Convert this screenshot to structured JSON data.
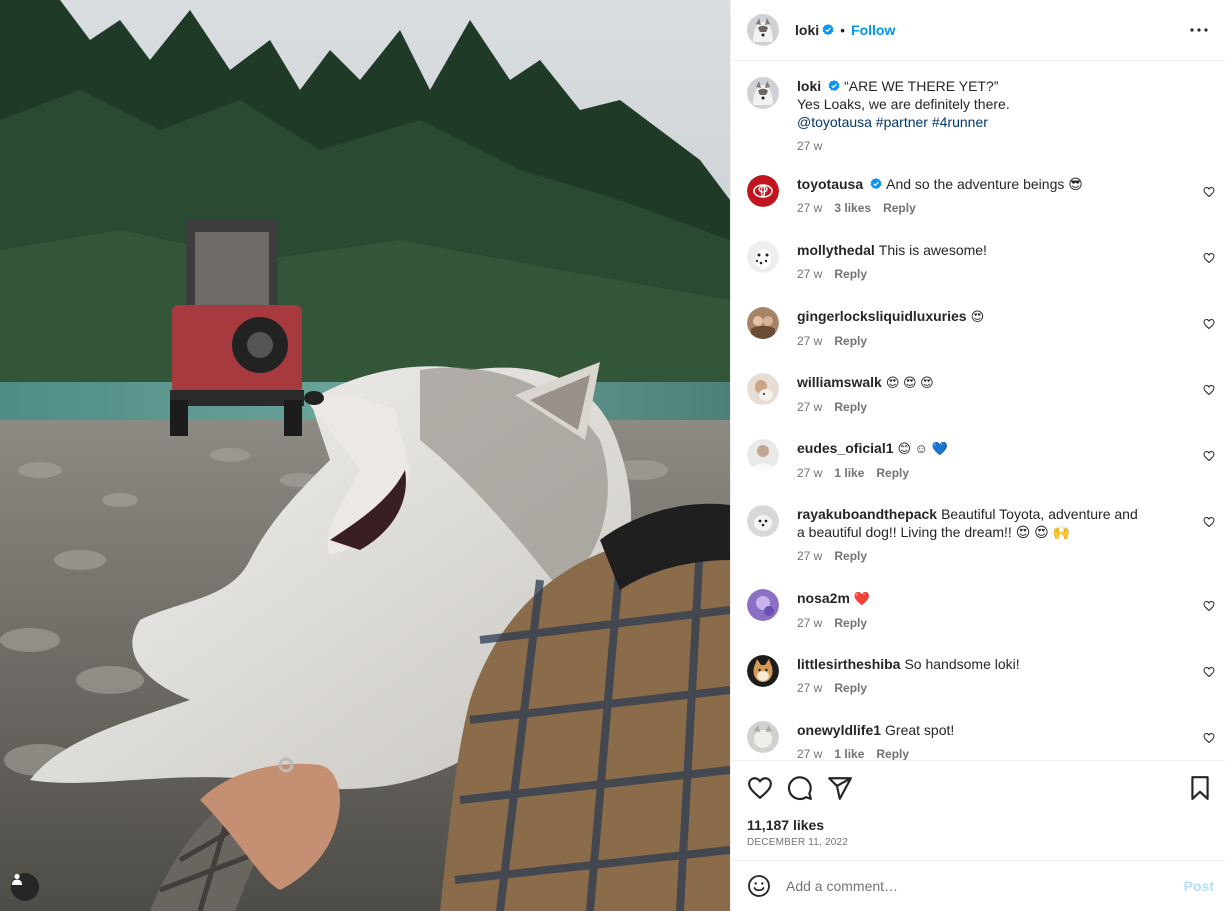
{
  "header": {
    "username": "loki",
    "dot": "•",
    "follow_label": "Follow"
  },
  "caption": {
    "username": "loki",
    "line1": "“ARE WE THERE YET?”",
    "line2": "Yes Loaks, we are definitely there.",
    "tags": "@toyotausa #partner #4runner",
    "time": "27 w"
  },
  "comments": [
    {
      "username": "toyotausa",
      "text": "And so the adventure beings 😎",
      "time": "27 w",
      "likes": "3 likes",
      "reply": "Reply"
    },
    {
      "username": "mollythedal",
      "text": "This is awesome!",
      "time": "27 w",
      "likes": "",
      "reply": "Reply"
    },
    {
      "username": "gingerlocksliquidluxuries",
      "text": "😍",
      "time": "27 w",
      "likes": "",
      "reply": "Reply"
    },
    {
      "username": "williamswalk",
      "text": "😍 😍 😍",
      "time": "27 w",
      "likes": "",
      "reply": "Reply"
    },
    {
      "username": "eudes_oficial1",
      "text": "😊 ☺ 💙",
      "time": "27 w",
      "likes": "1 like",
      "reply": "Reply"
    },
    {
      "username": "rayakuboandthepack",
      "text": "Beautiful Toyota, adventure and a beautiful dog!! Living the dream!! 😍 😍 🙌",
      "time": "27 w",
      "likes": "",
      "reply": "Reply"
    },
    {
      "username": "nosa2m",
      "text": "❤️",
      "time": "27 w",
      "likes": "",
      "reply": "Reply"
    },
    {
      "username": "littlesirtheshiba",
      "text": "So handsome loki!",
      "time": "27 w",
      "likes": "",
      "reply": "Reply"
    },
    {
      "username": "onewyldlife1",
      "text": "Great spot!",
      "time": "27 w",
      "likes": "1 like",
      "reply": "Reply"
    }
  ],
  "footer": {
    "likes": "11,187 likes",
    "date": "DECEMBER 11, 2022",
    "comment_placeholder": "Add a comment…",
    "post_label": "Post"
  },
  "icons": {
    "more": "more-horizontal-icon",
    "like": "heart-icon",
    "comment": "comment-icon",
    "share": "paper-plane-icon",
    "save": "bookmark-icon",
    "emoji": "smiley-icon",
    "verified": "verified-badge-icon",
    "user_tag": "person-icon"
  },
  "colors": {
    "accent": "#0095f6",
    "verified": "#0095f6",
    "link": "#00376b",
    "post_disabled": "#b2dffc"
  }
}
